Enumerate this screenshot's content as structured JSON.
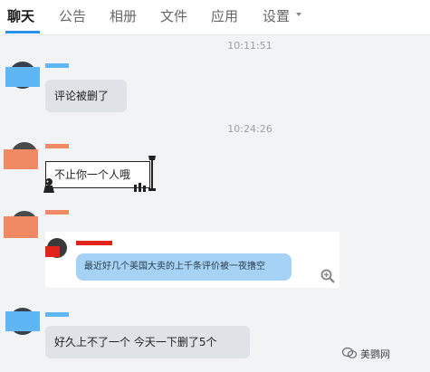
{
  "tabs": [
    {
      "label": "聊天",
      "active": true
    },
    {
      "label": "公告"
    },
    {
      "label": "相册"
    },
    {
      "label": "文件"
    },
    {
      "label": "应用"
    },
    {
      "label": "设置"
    }
  ],
  "messages": {
    "ts1": "10:11:51",
    "msg1": "评论被删了",
    "ts2": "10:24:26",
    "msg2": "不止你一个人哦",
    "share_text": "最近好几个美国大卖的上千条评价被一夜撸空",
    "msg4": "好久上不了一个   今天一下删了5个"
  },
  "watermark": "美鹦网",
  "colors": {
    "accent": "#2a8fe6",
    "blue_avatar": "#5eb6f4",
    "salmon_avatar": "#f08a64",
    "red_name": "#e0241c",
    "bubble_gray": "#dfe3e8",
    "bubble_blue": "#a6d3f5"
  }
}
